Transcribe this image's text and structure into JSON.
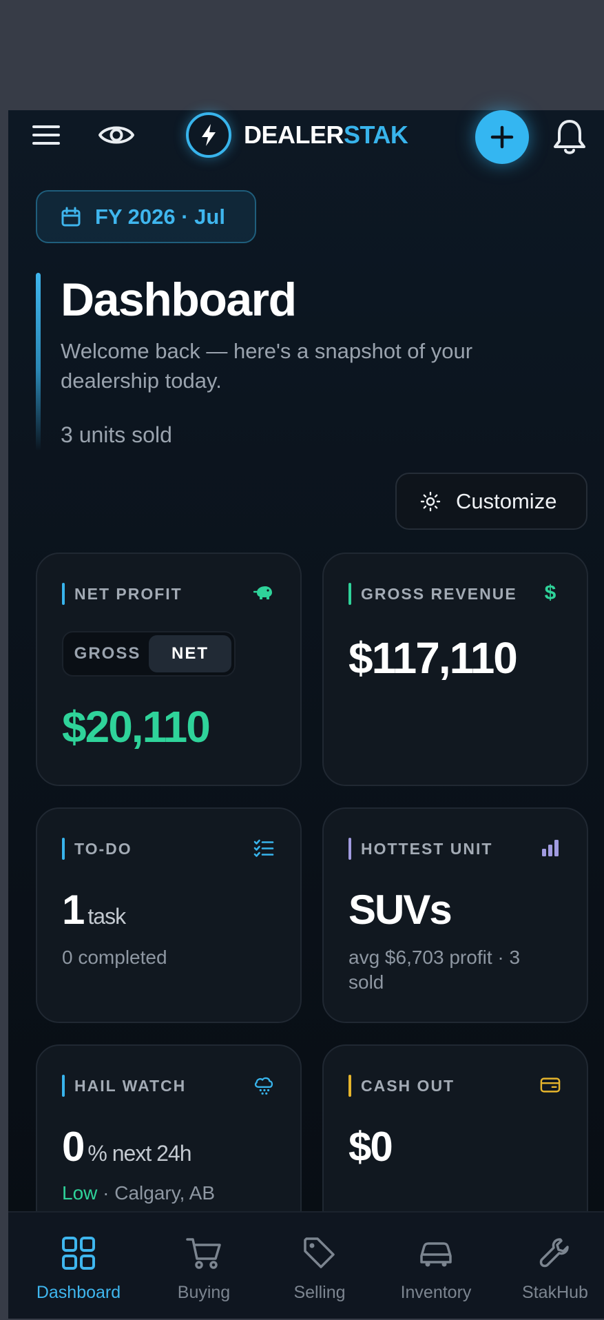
{
  "header": {
    "brand_part1": "DEALER",
    "brand_part2": "STAK",
    "icons": [
      "menu-icon",
      "eye-icon",
      "lightning-icon",
      "plus-icon",
      "bell-icon"
    ]
  },
  "period": {
    "label": "FY 2026 · Jul"
  },
  "page": {
    "title": "Dashboard",
    "subtitle": "Welcome back — here's a snapshot of your dealership today.",
    "units_sold": "3 units sold",
    "customize_label": "Customize"
  },
  "cards": {
    "net_profit": {
      "label": "NET PROFIT",
      "toggle_options": [
        "GROSS",
        "NET"
      ],
      "toggle_selected": "NET",
      "value": "$20,110",
      "icon": "piggy-bank-icon"
    },
    "gross_revenue": {
      "label": "GROSS REVENUE",
      "value": "$117,110",
      "icon": "dollar-icon"
    },
    "todo": {
      "label": "TO-DO",
      "value": "1",
      "unit": "task",
      "detail": "0 completed",
      "icon": "checklist-icon"
    },
    "hottest_unit": {
      "label": "HOTTEST UNIT",
      "value": "SUVs",
      "detail": "avg $6,703 profit · 3 sold",
      "icon": "bar-chart-icon"
    },
    "hail_watch": {
      "label": "HAIL WATCH",
      "value": "0",
      "unit": "% next 24h",
      "risk": "Low",
      "location": " · Calgary, AB",
      "icon": "cloud-hail-icon"
    },
    "cash_out": {
      "label": "CASH OUT",
      "value": "$0",
      "icon": "wallet-icon"
    }
  },
  "colors": {
    "accent_blue": "#38b4ec",
    "profit_green": "#2fd39a",
    "violet": "#a19be0",
    "amber": "#e6b52c"
  },
  "nav": {
    "items": [
      {
        "label": "Dashboard",
        "icon": "grid-icon",
        "active": true
      },
      {
        "label": "Buying",
        "icon": "cart-icon",
        "active": false
      },
      {
        "label": "Selling",
        "icon": "tag-icon",
        "active": false
      },
      {
        "label": "Inventory",
        "icon": "car-icon",
        "active": false
      },
      {
        "label": "StakHub",
        "icon": "wrench-icon",
        "active": false
      }
    ]
  }
}
